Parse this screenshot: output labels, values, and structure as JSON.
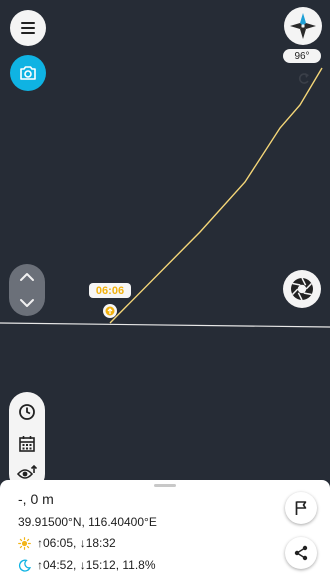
{
  "colors": {
    "map_background": "#262c36",
    "sun_path": "#f4d678",
    "horizon": "#e8e8e8",
    "camera_accent": "#0fb3e3",
    "time_label": "#f1b10f",
    "sun_icon": "#f2b51a",
    "moon_icon": "#0fb3e3"
  },
  "icons": {
    "menu": "hamburger-menu-icon",
    "camera": "camera-icon",
    "compass": "compass-rose-icon",
    "undo": "rotate-back-icon",
    "aperture": "aperture-shutter-icon",
    "stepper_up": "chevron-up-icon",
    "stepper_down": "chevron-down-icon",
    "clock": "clock-icon",
    "calendar": "calendar-icon",
    "eye": "eye-arrow-icon",
    "sun": "sun-icon",
    "moon": "moon-icon",
    "flag": "flag-icon",
    "share": "share-icon"
  },
  "compass": {
    "heading": "96°"
  },
  "overlay": {
    "time_label": "06:06"
  },
  "info": {
    "altitude": "-, 0 m",
    "coordinates": "39.91500°N, 116.40400°E",
    "sun_times": "↑06:05, ↓18:32",
    "moon_times": "↑04:52, ↓15:12, 11.8%"
  }
}
